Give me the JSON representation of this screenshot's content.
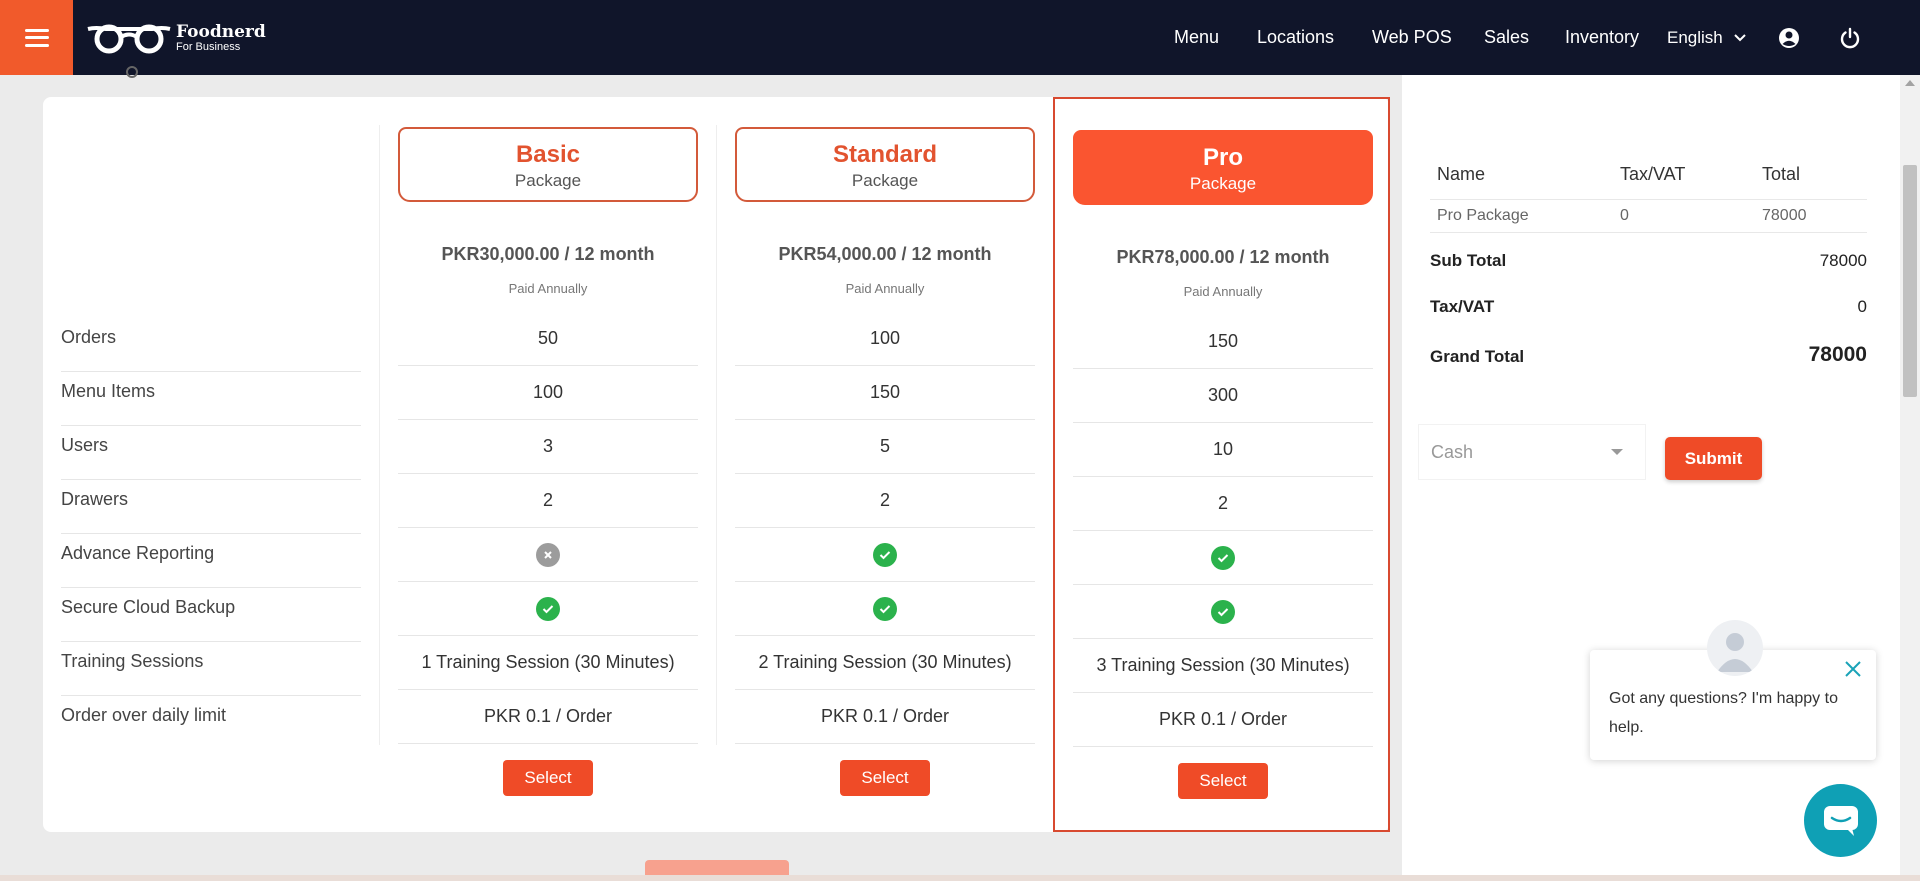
{
  "header": {
    "brand_name": "Foodnerd",
    "brand_tagline": "For Business",
    "nav": [
      "Menu",
      "Locations",
      "Web POS",
      "Sales",
      "Inventory"
    ],
    "language": "English"
  },
  "pricing": {
    "features": [
      "Orders",
      "Menu Items",
      "Users",
      "Drawers",
      "Advance Reporting",
      "Secure Cloud Backup",
      "Training Sessions",
      "Order over daily limit"
    ],
    "plans": [
      {
        "name": "Basic",
        "subtitle": "Package",
        "price": "PKR30,000.00 / 12 month",
        "billing": "Paid Annually",
        "values": [
          "50",
          "100",
          "3",
          "2"
        ],
        "advance_reporting": "no",
        "cloud_backup": "yes",
        "training": "1 Training Session (30 Minutes)",
        "overage": "PKR 0.1 / Order",
        "button": "Select"
      },
      {
        "name": "Standard",
        "subtitle": "Package",
        "price": "PKR54,000.00 / 12 month",
        "billing": "Paid Annually",
        "values": [
          "100",
          "150",
          "5",
          "2"
        ],
        "advance_reporting": "yes",
        "cloud_backup": "yes",
        "training": "2 Training Session (30 Minutes)",
        "overage": "PKR 0.1 / Order",
        "button": "Select"
      },
      {
        "name": "Pro",
        "subtitle": "Package",
        "price": "PKR78,000.00 / 12 month",
        "billing": "Paid Annually",
        "values": [
          "150",
          "300",
          "10",
          "2"
        ],
        "advance_reporting": "yes",
        "cloud_backup": "yes",
        "training": "3 Training Session (30 Minutes)",
        "overage": "PKR 0.1 / Order",
        "button": "Select"
      }
    ]
  },
  "summary": {
    "columns": [
      "Name",
      "Tax/VAT",
      "Total"
    ],
    "row": {
      "name": "Pro Package",
      "tax": "0",
      "total": "78000"
    },
    "subtotal_label": "Sub Total",
    "subtotal": "78000",
    "tax_label": "Tax/VAT",
    "tax": "0",
    "grand_label": "Grand Total",
    "grand": "78000",
    "payment_method": "Cash",
    "submit": "Submit"
  },
  "chat": {
    "message": "Got any questions? I'm happy to help."
  },
  "colors": {
    "accent": "#ef4b27",
    "navbar": "#10152a",
    "check": "#2bb24c",
    "chat": "#0fa0b5"
  }
}
